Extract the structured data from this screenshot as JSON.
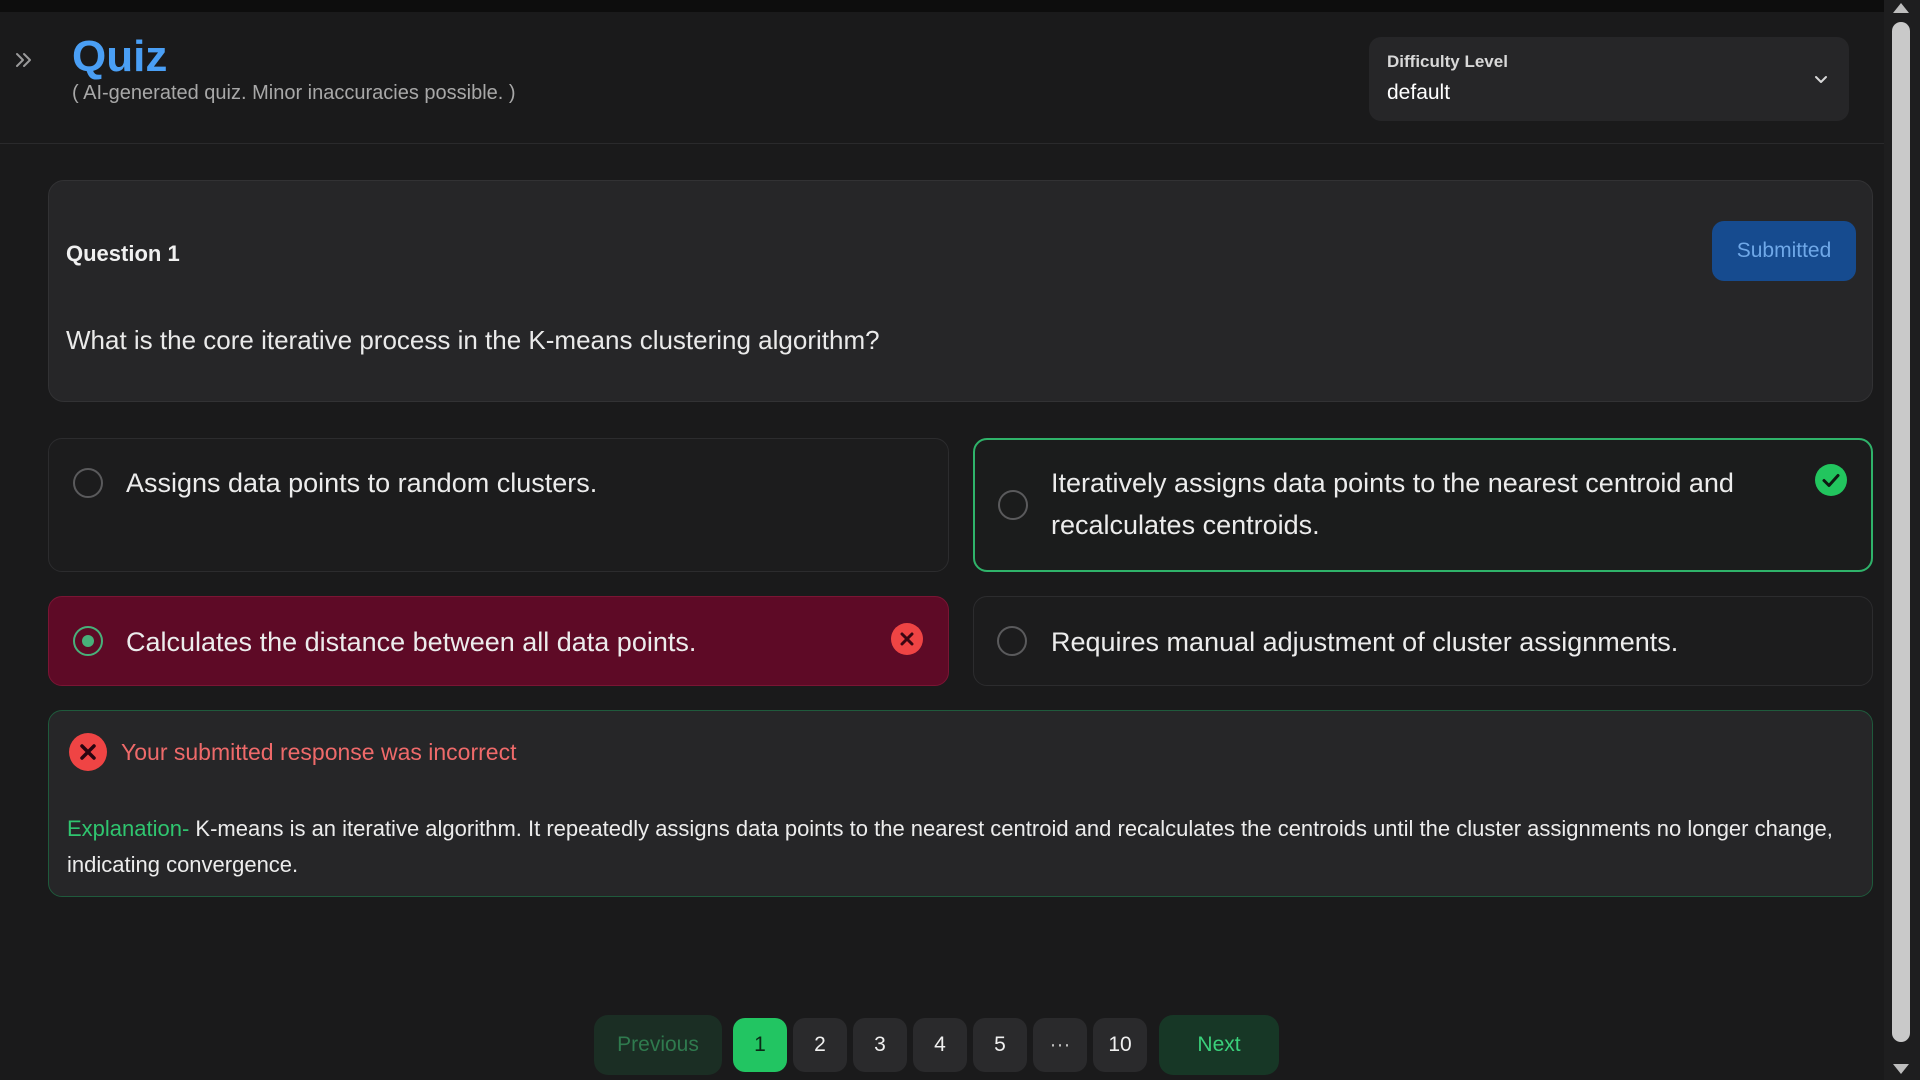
{
  "header": {
    "title": "Quiz",
    "subtitle": "( AI-generated quiz. Minor inaccuracies possible. )",
    "difficulty_label": "Difficulty Level",
    "difficulty_value": "default"
  },
  "question": {
    "number_label": "Question 1",
    "status_button": "Submitted",
    "text": "What is the core iterative process in the K-means clustering algorithm?"
  },
  "options": [
    {
      "text": "Assigns data points to random clusters.",
      "state": "unselected"
    },
    {
      "text": "Iteratively assigns data points to the nearest centroid and recalculates centroids.",
      "state": "correct"
    },
    {
      "text": "Calculates the distance between all data points.",
      "state": "selected-incorrect"
    },
    {
      "text": "Requires manual adjustment of cluster assignments.",
      "state": "unselected"
    }
  ],
  "feedback": {
    "title": "Your submitted response was incorrect",
    "explanation_label": "Explanation-",
    "explanation_text": " K-means is an iterative algorithm. It repeatedly assigns data points to the nearest centroid and recalculates the centroids until the cluster assignments no longer change, indicating convergence."
  },
  "pagination": {
    "previous": "Previous",
    "next": "Next",
    "pages": [
      "1",
      "2",
      "3",
      "4",
      "5",
      "···",
      "10"
    ],
    "current": "1"
  },
  "icons": {
    "expand": "double-chevron-right-icon",
    "dropdown": "chevron-down-icon",
    "correct": "check-circle-icon",
    "incorrect": "x-circle-icon"
  },
  "colors": {
    "accent_blue": "#4a9ff5",
    "correct_green": "#22c55e",
    "incorrect_red": "#ef4444",
    "incorrect_bg": "#5e0a26"
  }
}
